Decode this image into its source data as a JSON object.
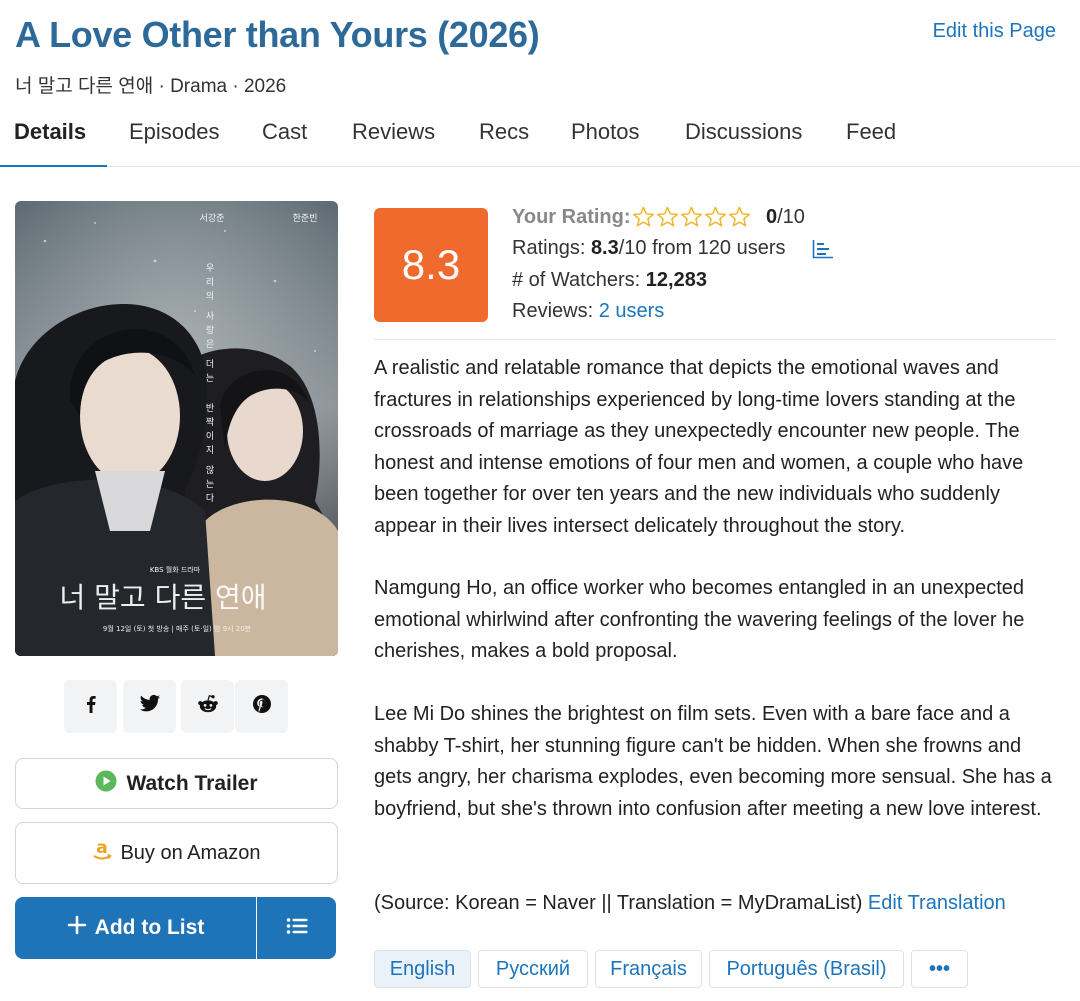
{
  "header": {
    "title": "A Love Other than Yours (2026)",
    "edit_link": "Edit this Page",
    "subtitle": "너 말고 다른 연애 · Drama · 2026"
  },
  "tabs": [
    {
      "label": "Details",
      "active": true
    },
    {
      "label": "Episodes"
    },
    {
      "label": "Cast"
    },
    {
      "label": "Reviews"
    },
    {
      "label": "Recs"
    },
    {
      "label": "Photos"
    },
    {
      "label": "Discussions"
    },
    {
      "label": "Feed"
    }
  ],
  "poster": {
    "korean_title": "너 말고 다른 연애",
    "vertical_text": "우리의 사랑은 더는 반짝이지 않는다",
    "top_left_name": "서강준",
    "top_right_name": "한준빈",
    "broadcaster": "KBS 월화 드라마",
    "date_line": "9월 12일 (토) 첫 방송 | 매주 (토·일) 밤 9시 20분"
  },
  "social": [
    {
      "name": "facebook",
      "glyph": "f"
    },
    {
      "name": "twitter"
    },
    {
      "name": "reddit"
    },
    {
      "name": "pinterest"
    }
  ],
  "actions": {
    "watch_trailer": "Watch Trailer",
    "buy_amazon": "Buy on Amazon",
    "add_to_list": "Add to List"
  },
  "score": {
    "value": "8.3",
    "your_rating_label": "Your Rating:",
    "your_rating_value": "0",
    "your_rating_suffix": "/10",
    "ratings_label": "Ratings:",
    "ratings_value": "8.3",
    "ratings_suffix": "/10 from 120 users",
    "watchers_label": "# of Watchers:",
    "watchers_value": "12,283",
    "reviews_label": "Reviews:",
    "reviews_link": "2 users",
    "star_count": 5
  },
  "synopsis": {
    "p1": "A realistic and relatable romance that depicts the emotional waves and fractures in relationships experienced by long-time lovers standing at the crossroads of marriage as they unexpectedly encounter new people. The honest and intense emotions of four men and women, a couple who have been together for over ten years and the new individuals who suddenly appear in their lives intersect delicately throughout the story.",
    "p2": "Namgung Ho, an office worker who becomes entangled in an unexpected emotional whirlwind after confronting the wavering feelings of the lover he cherishes, makes a bold proposal.",
    "p3": "Lee Mi Do shines the brightest on film sets. Even with a bare face and a shabby T-shirt, her stunning figure can't be hidden. When she frowns and gets angry, her charisma explodes, even becoming more sensual. She has a boyfriend, but she's thrown into confusion after meeting a new love interest.",
    "source": "(Source: Korean = Naver || Translation = MyDramaList)",
    "edit_translation": "Edit Translation"
  },
  "languages": [
    {
      "label": "English",
      "active": true
    },
    {
      "label": "Русский"
    },
    {
      "label": "Français"
    },
    {
      "label": "Português (Brasil)"
    },
    {
      "label": "•••"
    }
  ],
  "colors": {
    "title": "#2d6a99",
    "link": "#1c75bc",
    "score_bg": "#f06a2e",
    "primary_button": "#1f73b7",
    "trailer_play": "#5cb85c",
    "amazon": "#f0a11e"
  }
}
